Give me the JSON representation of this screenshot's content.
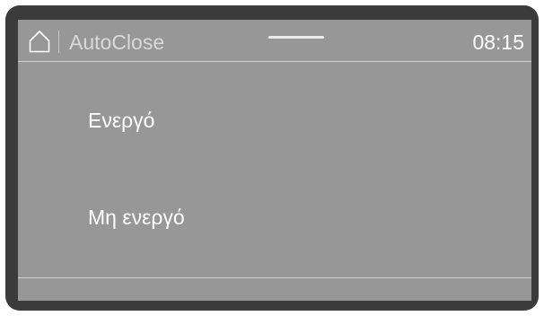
{
  "header": {
    "home_icon": "home-icon",
    "title": "AutoClose",
    "time": "08:15"
  },
  "options": [
    {
      "label": "Ενεργό"
    },
    {
      "label": "Μη ενεργό"
    }
  ],
  "colors": {
    "bezel": "#3b3b3b",
    "screen": "#979797",
    "text": "#ffffff",
    "title_text": "#d9d9d9",
    "rule": "#cfcfcf"
  }
}
